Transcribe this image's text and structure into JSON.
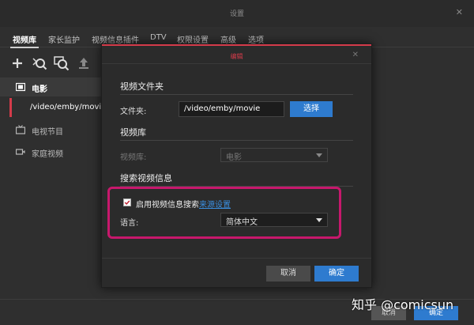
{
  "window": {
    "title": "设置",
    "close_glyph": "✕"
  },
  "tabs": [
    {
      "label": "视频库",
      "active": true
    },
    {
      "label": "家长监护"
    },
    {
      "label": "视频信息插件"
    },
    {
      "label": "DTV"
    },
    {
      "label": "权限设置"
    },
    {
      "label": "高级"
    },
    {
      "label": "选项"
    }
  ],
  "toolbar": {
    "icons": [
      "add-icon",
      "search-metadata-icon",
      "refresh-metadata-icon",
      "upload-icon"
    ]
  },
  "libraries": {
    "movies": {
      "label": "电影",
      "icon": "film-icon"
    },
    "movies_path": "/video/emby/movie",
    "tv": {
      "label": "电视节目",
      "icon": "tv-icon"
    },
    "home": {
      "label": "家庭视频",
      "icon": "video-camera-icon"
    }
  },
  "footer": {
    "cancel_label": "取消",
    "ok_label": "确定"
  },
  "watermark": "知乎 @comicsun",
  "modal": {
    "title": "编辑",
    "close_glyph": "✕",
    "folder_section": "视频文件夹",
    "folder_label": "文件夹:",
    "folder_value": "/video/emby/movie",
    "choose_label": "选择",
    "library_section": "视频库",
    "library_label": "视频库:",
    "library_value": "电影",
    "search_section": "搜索视频信息",
    "enable_label": "启用视频信息搜索",
    "enable_checked": true,
    "source_link": "来源设置",
    "language_label": "语言:",
    "language_value": "简体中文",
    "cancel_label": "取消",
    "ok_label": "确定"
  },
  "colors": {
    "accent": "#d43b4a",
    "primary": "#2e7bcf",
    "highlight": "#c7186c",
    "link": "#3a8fe0"
  }
}
